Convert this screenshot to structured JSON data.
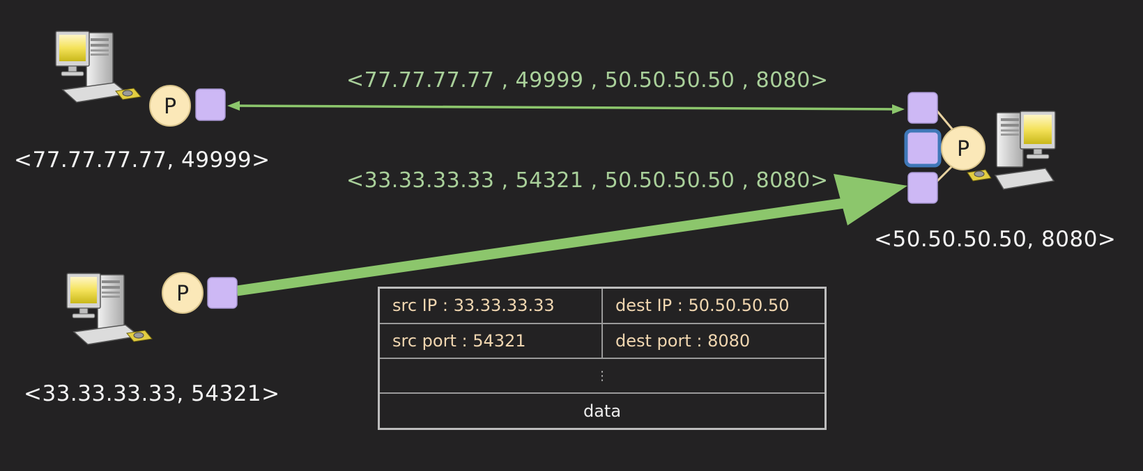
{
  "hosts": {
    "client_a": {
      "address": "<77.77.77.77, 49999>",
      "process": "P"
    },
    "client_b": {
      "address": "<33.33.33.33, 54321>",
      "process": "P"
    },
    "server": {
      "address": "<50.50.50.50, 8080>",
      "process": "P"
    }
  },
  "connections": [
    {
      "tuple": "<77.77.77.77 , 49999 , 50.50.50.50 , 8080>"
    },
    {
      "tuple": "<33.33.33.33 , 54321 , 50.50.50.50 , 8080>"
    }
  ],
  "segment_header": {
    "src_ip": "src IP : 33.33.33.33",
    "dest_ip": "dest IP : 50.50.50.50",
    "src_port": "src port : 54321",
    "dest_port": "dest port : 8080",
    "ellipsis": "⋮",
    "data": "data"
  },
  "colors": {
    "background": "#232223",
    "arrow": "#8cc66c",
    "socket": "#cdb8f5",
    "active_socket_border": "#3f78b8",
    "process": "#fbe8b8",
    "tuple_text": "#a9d09a",
    "header_text": "#f0d6b0"
  },
  "icons": [
    "computer-icon",
    "process-circle",
    "socket-square"
  ]
}
